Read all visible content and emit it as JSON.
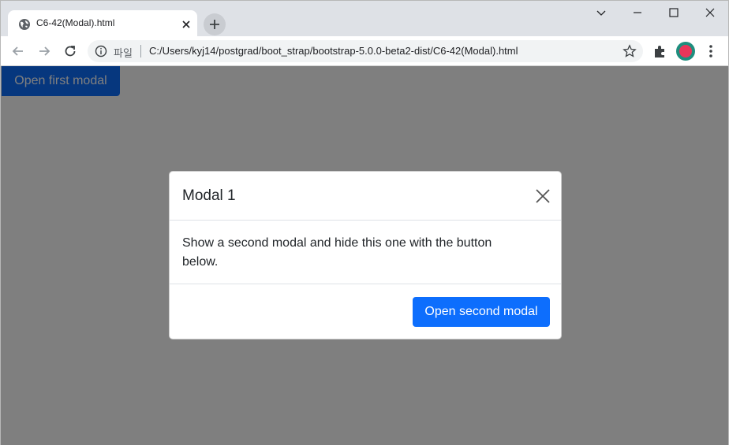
{
  "browser": {
    "tab_title": "C6-42(Modal).html",
    "file_chip": "파일",
    "url": "C:/Users/kyj14/postgrad/boot_strap/bootstrap-5.0.0-beta2-dist/C6-42(Modal).html"
  },
  "page": {
    "open_first_label": "Open first modal"
  },
  "modal": {
    "title": "Modal 1",
    "body_text": "Show a second modal and hide this one with the button below.",
    "open_second_label": "Open second modal"
  },
  "colors": {
    "primary": "#0d6efd",
    "backdrop": "rgba(0,0,0,0.5)",
    "tabstrip": "#dee1e6"
  },
  "icons": {
    "favicon": "globe-icon",
    "close": "close-icon",
    "new_tab": "plus-icon",
    "minimize": "minimize-icon",
    "maximize": "maximize-icon",
    "window_close": "window-close-icon",
    "back": "back-arrow-icon",
    "forward": "forward-arrow-icon",
    "reload": "reload-icon",
    "info": "info-icon",
    "bookmark": "star-icon",
    "extensions": "puzzle-icon",
    "profile": "profile-avatar",
    "menu": "kebab-menu-icon"
  }
}
